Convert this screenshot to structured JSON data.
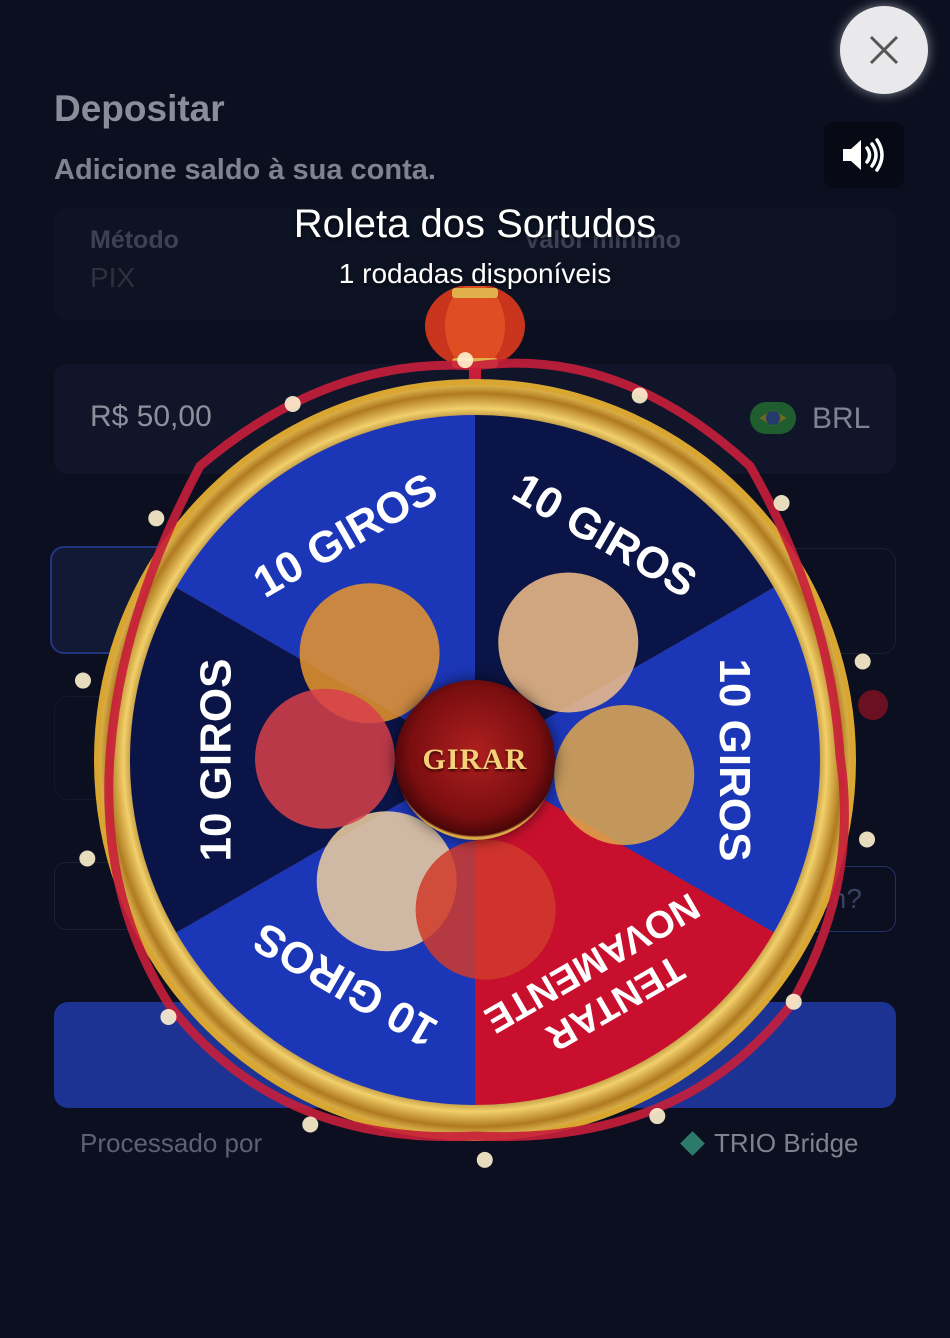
{
  "page": {
    "title": "Depositar",
    "subtitle": "Adicione saldo à sua conta.",
    "method_label": "Método",
    "method_value": "PIX",
    "min_label": "Valor mínimo",
    "amount_value": "R$ 50,00",
    "currency": "BRL",
    "coupon_text": "m?",
    "processed_by": "Processado por",
    "brand": "TRIO Bridge"
  },
  "overlay": {
    "title": "Roleta dos Sortudos",
    "subtitle": "1 rodadas disponíveis",
    "spin_label": "GIRAR",
    "close_icon": "close-icon",
    "sound_icon": "speaker-volume-icon"
  },
  "wheel": {
    "segments": [
      {
        "label": "10 GIROS",
        "color": "#0b1446"
      },
      {
        "label": "10 GIROS",
        "color": "#1c36b8"
      },
      {
        "label": "TENTAR NOVAMENTE",
        "color": "#c8102e"
      },
      {
        "label": "10 GIROS",
        "color": "#1c36b8"
      },
      {
        "label": "10 GIROS",
        "color": "#0b1446"
      },
      {
        "label": "10 GIROS",
        "color": "#1c36b8"
      }
    ],
    "rim_color": "#d9a632",
    "ribbon_color": "#c81e3a"
  }
}
